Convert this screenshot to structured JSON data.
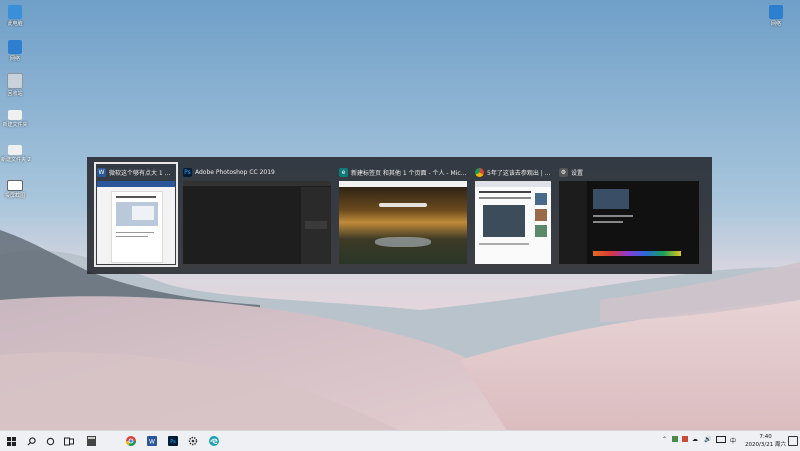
{
  "desktop": {
    "icons": [
      {
        "name": "此电脑",
        "icon": "computer-icon"
      },
      {
        "name": "网络",
        "icon": "network-icon"
      },
      {
        "name": "回收站",
        "icon": "recycle-bin-icon"
      },
      {
        "name": "新建文件夹",
        "icon": "folder-icon"
      },
      {
        "name": "新建文件夹 2",
        "icon": "folder-icon"
      },
      {
        "name": "投屏截图",
        "icon": "screenshot-icon"
      },
      {
        "name": "网络",
        "icon": "network-icon"
      }
    ]
  },
  "switcher": {
    "windows": [
      {
        "title": "微软这个够有点大 1 ...",
        "app_icon": "word-icon",
        "color": "#2b5797",
        "selected": true
      },
      {
        "title": "Adobe Photoshop CC 2019",
        "app_icon": "photoshop-icon",
        "color": "#1e2a3a",
        "selected": false
      },
      {
        "title": "新建标签页 和其他 1 个页面 - 个人 - Microsof...",
        "app_icon": "edge-icon",
        "color": "#0f7a7a",
        "selected": false
      },
      {
        "title": "5年了这该去参观出 | ...",
        "app_icon": "chrome-icon",
        "color": "#d93025",
        "selected": false
      },
      {
        "title": "设置",
        "app_icon": "settings-gear-icon",
        "color": "#555555",
        "selected": false
      }
    ]
  },
  "taskbar": {
    "apps": [
      {
        "name": "start",
        "icon": "windows-start-icon"
      },
      {
        "name": "search",
        "icon": "search-icon"
      },
      {
        "name": "cortana",
        "icon": "cortana-icon"
      },
      {
        "name": "task-view",
        "icon": "task-view-icon"
      },
      {
        "name": "calculator",
        "icon": "calculator-icon"
      },
      {
        "name": "chrome",
        "icon": "chrome-icon"
      },
      {
        "name": "word",
        "icon": "word-icon"
      },
      {
        "name": "photoshop",
        "icon": "photoshop-icon"
      },
      {
        "name": "settings",
        "icon": "gear-icon"
      },
      {
        "name": "edge",
        "icon": "edge-icon"
      }
    ],
    "clock_time": "7:40",
    "clock_date": "2020/3/21 周六",
    "ime": "中"
  }
}
